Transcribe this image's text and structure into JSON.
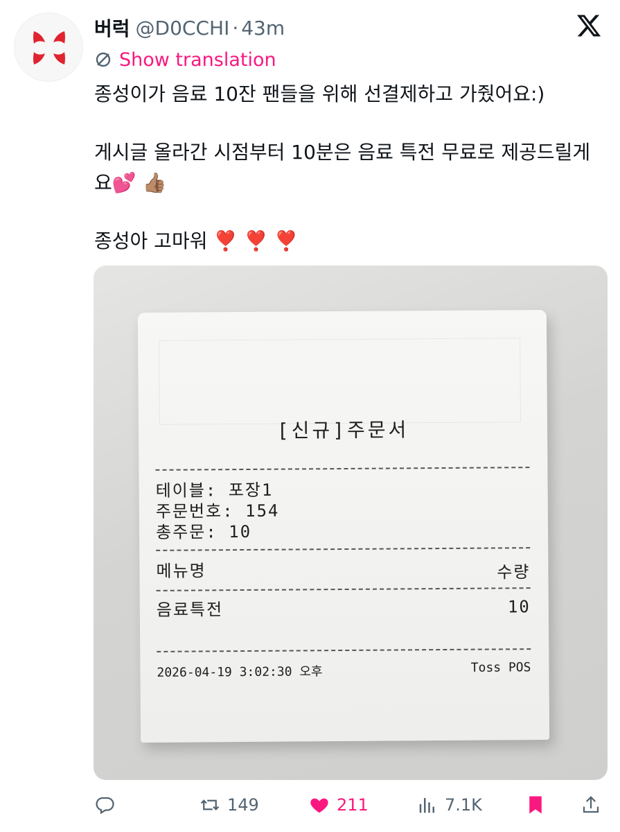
{
  "author": {
    "name": "버럭",
    "handle": "@D0CCHI",
    "separator": "·",
    "time": "43m"
  },
  "translate": {
    "label": "Show translation"
  },
  "tweet": {
    "paragraph1": "종성이가 음료 10잔 팬들을 위해 선결제하고 가줬어요:)",
    "paragraph2": "게시글 올라간 시점부터 10분은 음료 특전 무료로 제공드릴게요💕 👍🏽",
    "paragraph3": "종성아 고마워 ❣️ ❣️ ❣️"
  },
  "receipt": {
    "title": "[신규]주문서",
    "table": "테이블: 포장1",
    "order_number": "주문번호: 154",
    "total_orders": "총주문: 10",
    "menu_header": "메뉴명",
    "qty_header": "수량",
    "item_name": "음료특전",
    "item_qty": "10",
    "datetime": "2026-04-19 3:02:30 오후",
    "pos": "Toss POS"
  },
  "actions": {
    "retweets": "149",
    "likes": "211",
    "views": "7.1K"
  },
  "colors": {
    "like": "#f91880",
    "muted": "#536471",
    "avatar_mark": "#e0242f"
  },
  "icons": [
    "reply-icon",
    "retweet-icon",
    "heart-icon",
    "views-icon",
    "bookmark-icon",
    "share-icon",
    "x-logo-icon",
    "translate-icon"
  ]
}
